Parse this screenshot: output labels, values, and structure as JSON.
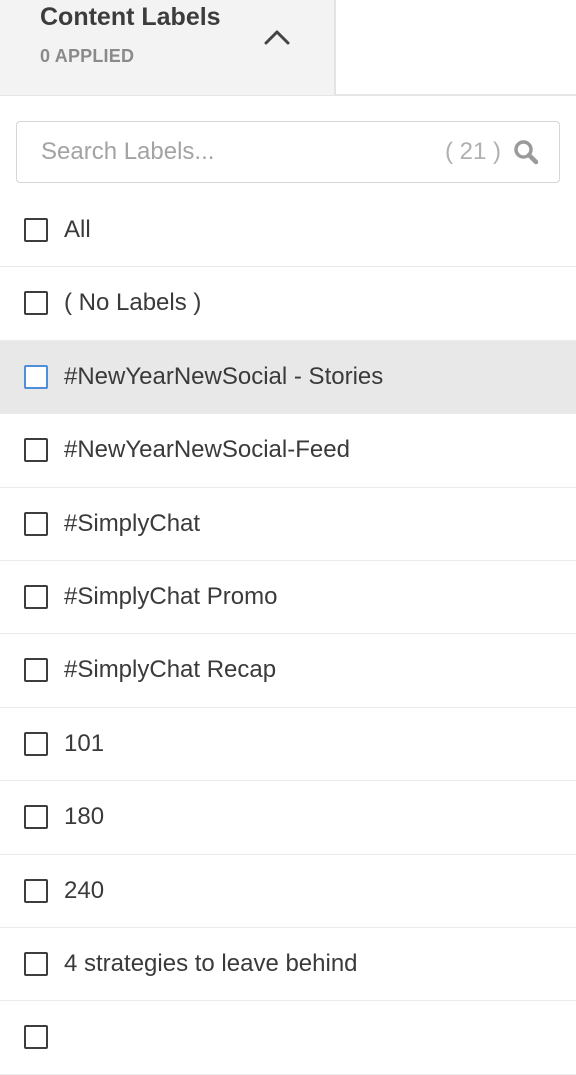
{
  "header": {
    "title": "Content Labels",
    "subtitle": "0 APPLIED",
    "toggle_icon": "chevron-up-icon"
  },
  "search": {
    "placeholder": "Search Labels...",
    "value": "",
    "count": "( 21 )",
    "icon": "search-icon"
  },
  "colors": {
    "header_bg": "#f3f3f3",
    "highlight_row_bg": "#e8e8e8",
    "checkbox_border": "#3d3d3d",
    "checkbox_focus_border": "#4f8fd9",
    "divider": "#ebebeb"
  },
  "labels": {
    "items": [
      {
        "label": "All",
        "checked": false,
        "highlighted": false
      },
      {
        "label": "( No Labels )",
        "checked": false,
        "highlighted": false
      },
      {
        "label": "#NewYearNewSocial - Stories",
        "checked": false,
        "highlighted": true
      },
      {
        "label": "#NewYearNewSocial-Feed",
        "checked": false,
        "highlighted": false
      },
      {
        "label": "#SimplyChat",
        "checked": false,
        "highlighted": false
      },
      {
        "label": "#SimplyChat Promo",
        "checked": false,
        "highlighted": false
      },
      {
        "label": "#SimplyChat Recap",
        "checked": false,
        "highlighted": false
      },
      {
        "label": "101",
        "checked": false,
        "highlighted": false
      },
      {
        "label": "180",
        "checked": false,
        "highlighted": false
      },
      {
        "label": "240",
        "checked": false,
        "highlighted": false
      },
      {
        "label": "4 strategies to leave behind",
        "checked": false,
        "highlighted": false
      },
      {
        "label": "",
        "checked": false,
        "highlighted": false
      }
    ]
  }
}
